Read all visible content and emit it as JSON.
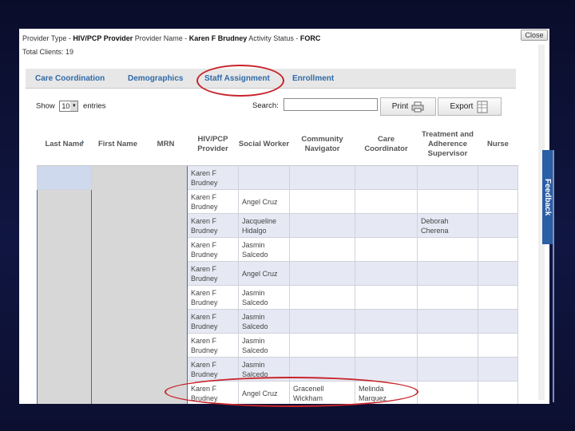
{
  "header": {
    "line1": {
      "provider_type_label": "Provider Type - ",
      "provider_type_value": "HIV/PCP Provider",
      "provider_name_label": " Provider Name - ",
      "provider_name_value": "Karen F Brudney",
      "activity_status_label": " Activity Status - ",
      "activity_status_value": "FORC"
    },
    "total_clients": "Total Clients: 19",
    "close_label": "Close"
  },
  "tabs": [
    {
      "label": "Care Coordination"
    },
    {
      "label": "Demographics"
    },
    {
      "label": "Staff Assignment"
    },
    {
      "label": "Enrollment"
    }
  ],
  "controls": {
    "show_label": "Show",
    "entries_value": "10",
    "entries_label": "entries",
    "search_label": "Search:",
    "search_value": "",
    "print_label": "Print",
    "export_label": "Export"
  },
  "table": {
    "columns": [
      "Last Name",
      "First Name",
      "MRN",
      "HIV/PCP Provider",
      "Social Worker",
      "Community Navigator",
      "Care Coordinator",
      "Treatment and Adherence Supervisor",
      "Nurse"
    ],
    "rows": [
      {
        "provider": "Karen F Brudney",
        "social_worker": "",
        "navigator": "",
        "coordinator": "",
        "supervisor": "",
        "nurse": ""
      },
      {
        "provider": "Karen F Brudney",
        "social_worker": "Angel Cruz",
        "navigator": "",
        "coordinator": "",
        "supervisor": "",
        "nurse": ""
      },
      {
        "provider": "Karen F Brudney",
        "social_worker": "Jacqueline Hidalgo",
        "navigator": "",
        "coordinator": "",
        "supervisor": "Deborah Cherena",
        "nurse": ""
      },
      {
        "provider": "Karen F Brudney",
        "social_worker": "Jasmin Salcedo",
        "navigator": "",
        "coordinator": "",
        "supervisor": "",
        "nurse": ""
      },
      {
        "provider": "Karen F Brudney",
        "social_worker": "Angel Cruz",
        "navigator": "",
        "coordinator": "",
        "supervisor": "",
        "nurse": ""
      },
      {
        "provider": "Karen F Brudney",
        "social_worker": "Jasmin Salcedo",
        "navigator": "",
        "coordinator": "",
        "supervisor": "",
        "nurse": ""
      },
      {
        "provider": "Karen F Brudney",
        "social_worker": "Jasmin Salcedo",
        "navigator": "",
        "coordinator": "",
        "supervisor": "",
        "nurse": ""
      },
      {
        "provider": "Karen F Brudney",
        "social_worker": "Jasmin Salcedo",
        "navigator": "",
        "coordinator": "",
        "supervisor": "",
        "nurse": ""
      },
      {
        "provider": "Karen F Brudney",
        "social_worker": "Jasmin Salcedo",
        "navigator": "",
        "coordinator": "",
        "supervisor": "",
        "nurse": ""
      },
      {
        "provider": "Karen F Brudney",
        "social_worker": "Angel Cruz",
        "navigator": "Gracenell Wickham",
        "coordinator": "Melinda Marquez",
        "supervisor": "",
        "nurse": ""
      }
    ]
  },
  "feedback_label": "Feedback",
  "colors": {
    "accent": "#2f6aa8",
    "highlight_oval": "#c8242b",
    "odd_row": "#e6e9f3",
    "redacted": "#d7d7d7"
  },
  "icons": {
    "print": "printer-icon",
    "export": "spreadsheet-icon",
    "sort": "sort-ascending-icon",
    "dropdown": "chevron-down-icon"
  }
}
